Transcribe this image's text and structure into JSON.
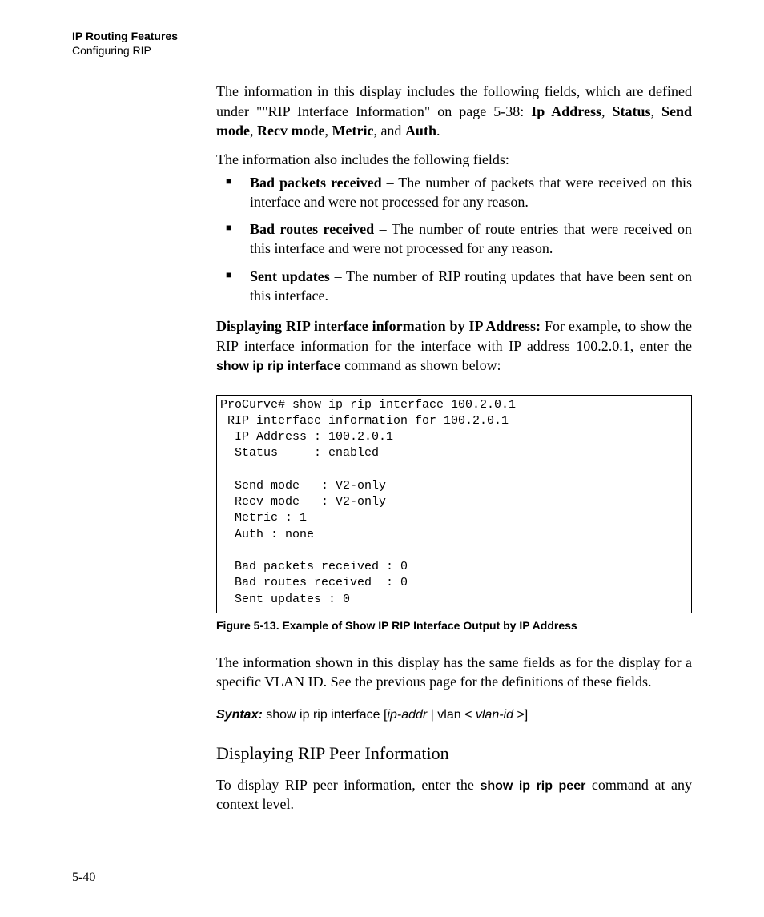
{
  "header": {
    "section": "IP Routing Features",
    "topic": "Configuring RIP"
  },
  "intro": {
    "p1_a": "The information in this display includes the following fields, which are defined under \"\"RIP Interface Information\" on page 5-38: ",
    "p1_fields": "Ip Address, Status, Send mode, Recv mode, Metric, and Auth.",
    "f1": "Ip Address",
    "f2": "Status",
    "f3": "Send mode",
    "f4": "Recv mode",
    "f5": "Metric",
    "f6": "Auth",
    "p2": "The information also includes the following fields:"
  },
  "bullets": [
    {
      "term": "Bad packets received",
      "desc": " – The number of packets that were received on this interface and were not processed for any reason."
    },
    {
      "term": "Bad routes received",
      "desc": " – The number of route entries that were received on this interface and were not processed for any reason."
    },
    {
      "term": "Sent updates",
      "desc": " – The number of RIP routing updates that have been sent on this interface."
    }
  ],
  "displaying": {
    "lead_bold": "Displaying RIP interface information by IP Address:",
    "lead_rest": "  For example, to show the RIP interface information for the interface with IP address 100.2.0.1, enter the ",
    "cmd": "show ip rip interface",
    "tail": " command as shown below:"
  },
  "code": "ProCurve# show ip rip interface 100.2.0.1\n RIP interface information for 100.2.0.1\n  IP Address : 100.2.0.1\n  Status     : enabled\n\n  Send mode   : V2-only\n  Recv mode   : V2-only\n  Metric : 1\n  Auth : none\n\n  Bad packets received : 0\n  Bad routes received  : 0\n  Sent updates : 0",
  "figure": {
    "caption": "Figure 5-13.  Example of Show IP RIP Interface Output by IP Address"
  },
  "after_fig": "The information shown in this display has the same fields as for the display for a specific VLAN ID. See the previous page for the definitions of these fields.",
  "syntax": {
    "label": "Syntax:",
    "cmd": "  show ip rip interface [",
    "arg1": "ip-addr",
    "mid": " | vlan < ",
    "arg2": "vlan-id ",
    "end": ">]"
  },
  "subsection": {
    "title": "Displaying RIP Peer Information",
    "p_a": "To display RIP peer information, enter the ",
    "p_cmd": "show ip rip peer",
    "p_b": " command at any context level."
  },
  "page_number": "5-40"
}
